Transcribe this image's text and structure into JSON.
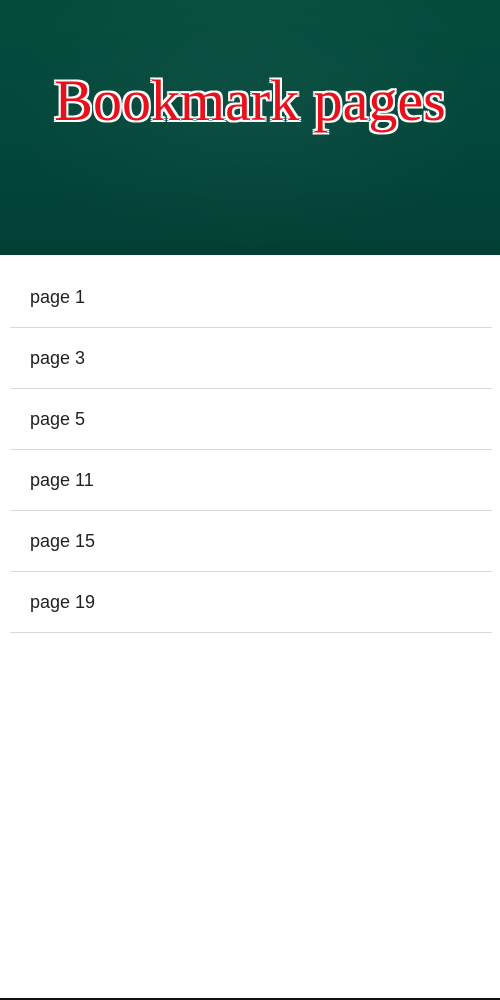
{
  "header": {
    "title": "Bookmark pages"
  },
  "bookmarks": [
    {
      "label": "page 1"
    },
    {
      "label": "page 3"
    },
    {
      "label": "page 5"
    },
    {
      "label": "page 11"
    },
    {
      "label": "page 15"
    },
    {
      "label": "page 19"
    }
  ],
  "colors": {
    "header_background": "#03463a",
    "title_text": "#e8101a",
    "title_outline": "#ffffff",
    "divider": "#d9d9d9",
    "item_text": "#212121"
  }
}
